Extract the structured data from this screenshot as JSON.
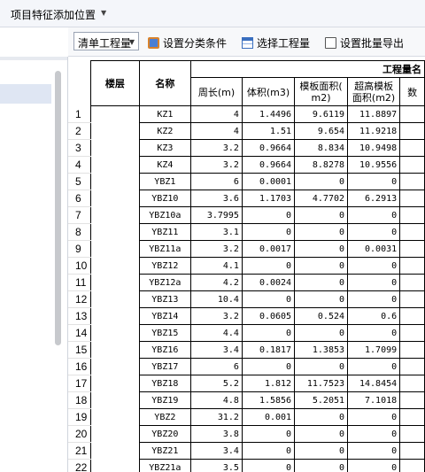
{
  "window": {
    "title": "项目特征添加位置"
  },
  "toolbar": {
    "dropdown_value": "清单工程量",
    "btn_classify": "设置分类条件",
    "btn_select": "选择工程量",
    "btn_export": "设置批量导出"
  },
  "table": {
    "group_header": "工程量名",
    "col_floor": "楼层",
    "col_name": "名称",
    "col_perimeter": "周长(m)",
    "col_volume": "体积(m3)",
    "col_formwork_l1": "模板面积(",
    "col_formwork_l2": "m2)",
    "col_high_l1": "超高模板",
    "col_high_l2": "面积(m2)",
    "col_extra": "数",
    "rows": [
      {
        "n": "1",
        "name": "KZ1",
        "p": "4",
        "v": "1.4496",
        "f": "9.6119",
        "h": "11.8897"
      },
      {
        "n": "2",
        "name": "KZ2",
        "p": "4",
        "v": "1.51",
        "f": "9.654",
        "h": "11.9218"
      },
      {
        "n": "3",
        "name": "KZ3",
        "p": "3.2",
        "v": "0.9664",
        "f": "8.834",
        "h": "10.9498"
      },
      {
        "n": "4",
        "name": "KZ4",
        "p": "3.2",
        "v": "0.9664",
        "f": "8.8278",
        "h": "10.9556"
      },
      {
        "n": "5",
        "name": "YBZ1",
        "p": "6",
        "v": "0.0001",
        "f": "0",
        "h": "0"
      },
      {
        "n": "6",
        "name": "YBZ10",
        "p": "3.6",
        "v": "1.1703",
        "f": "4.7702",
        "h": "6.2913"
      },
      {
        "n": "7",
        "name": "YBZ10a",
        "p": "3.7995",
        "v": "0",
        "f": "0",
        "h": "0"
      },
      {
        "n": "8",
        "name": "YBZ11",
        "p": "3.1",
        "v": "0",
        "f": "0",
        "h": "0"
      },
      {
        "n": "9",
        "name": "YBZ11a",
        "p": "3.2",
        "v": "0.0017",
        "f": "0",
        "h": "0.0031"
      },
      {
        "n": "10",
        "name": "YBZ12",
        "p": "4.1",
        "v": "0",
        "f": "0",
        "h": "0"
      },
      {
        "n": "11",
        "name": "YBZ12a",
        "p": "4.2",
        "v": "0.0024",
        "f": "0",
        "h": "0"
      },
      {
        "n": "12",
        "name": "YBZ13",
        "p": "10.4",
        "v": "0",
        "f": "0",
        "h": "0"
      },
      {
        "n": "13",
        "name": "YBZ14",
        "p": "3.2",
        "v": "0.0605",
        "f": "0.524",
        "h": "0.6"
      },
      {
        "n": "14",
        "name": "YBZ15",
        "p": "4.4",
        "v": "0",
        "f": "0",
        "h": "0"
      },
      {
        "n": "15",
        "name": "YBZ16",
        "p": "3.4",
        "v": "0.1817",
        "f": "1.3853",
        "h": "1.7099"
      },
      {
        "n": "16",
        "name": "YBZ17",
        "p": "6",
        "v": "0",
        "f": "0",
        "h": "0"
      },
      {
        "n": "17",
        "name": "YBZ18",
        "p": "5.2",
        "v": "1.812",
        "f": "11.7523",
        "h": "14.8454"
      },
      {
        "n": "18",
        "name": "YBZ19",
        "p": "4.8",
        "v": "1.5856",
        "f": "5.2051",
        "h": "7.1018"
      },
      {
        "n": "19",
        "name": "YBZ2",
        "p": "31.2",
        "v": "0.001",
        "f": "0",
        "h": "0"
      },
      {
        "n": "20",
        "name": "YBZ20",
        "p": "3.8",
        "v": "0",
        "f": "0",
        "h": "0"
      },
      {
        "n": "21",
        "name": "YBZ21",
        "p": "3.4",
        "v": "0",
        "f": "0",
        "h": "0"
      },
      {
        "n": "22",
        "name": "YBZ21a",
        "p": "3.5",
        "v": "0",
        "f": "0",
        "h": "0"
      }
    ]
  }
}
